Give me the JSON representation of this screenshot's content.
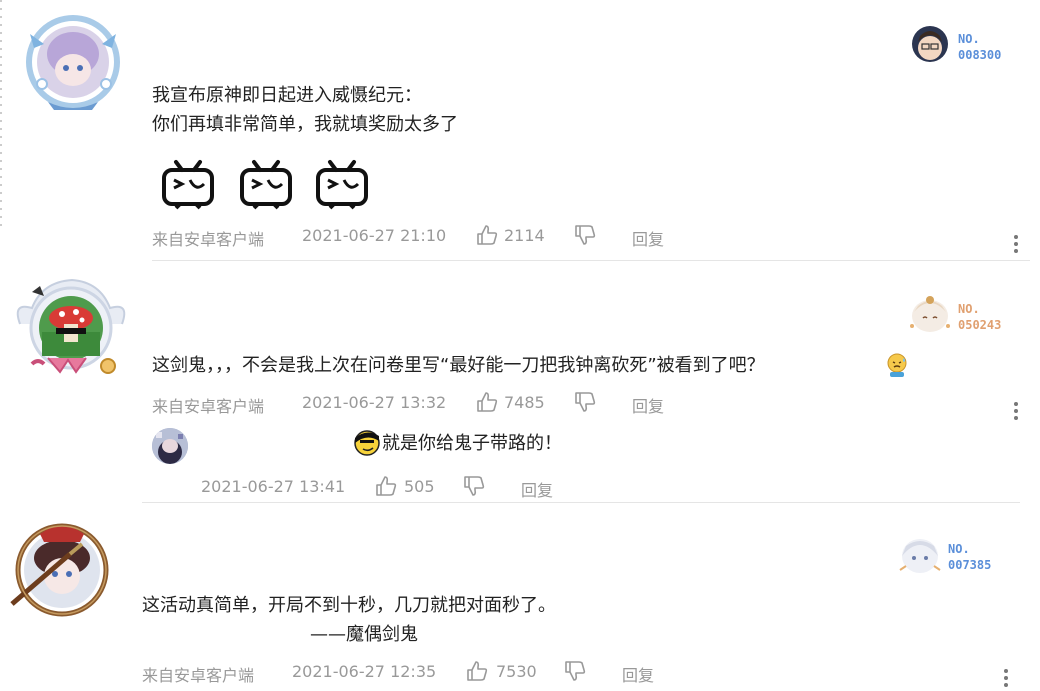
{
  "comments": [
    {
      "badge_no": "NO.",
      "badge_num": "008300",
      "badge_color": "#5b8fd9",
      "lines": [
        "我宣布原神即日起进入威慑纪元：",
        "你们再填非常简单，我就填奖励太多了"
      ],
      "stickers": [
        "tv-smirk-icon",
        "tv-smirk-icon",
        "tv-smirk-icon"
      ],
      "source": "来自安卓客户端",
      "time": "2021-06-27 21:10",
      "likes": "2114",
      "reply": "回复"
    },
    {
      "badge_no": "NO.",
      "badge_num": "050243",
      "badge_color": "#e0a070",
      "text": "这剑鬼，，，不会是我上次在问卷里写“最好能一刀把我钟离砍死”被看到了吧？",
      "emoji": "sweating-face-icon",
      "source": "来自安卓客户端",
      "time": "2021-06-27 13:32",
      "likes": "7485",
      "reply": "回复",
      "sub_reply": {
        "text": "就是你给鬼子带路的！",
        "emoji": "sly-face-icon",
        "time": "2021-06-27 13:41",
        "likes": "505",
        "reply": "回复"
      }
    },
    {
      "badge_no": "NO.",
      "badge_num": "007385",
      "badge_color": "#5b8fd9",
      "lines": [
        "这活动真简单，开局不到十秒，几刀就把对面秒了。",
        "——魔偶剑鬼"
      ],
      "source": "来自安卓客户端",
      "time": "2021-06-27 12:35",
      "likes": "7530",
      "reply": "回复"
    }
  ]
}
